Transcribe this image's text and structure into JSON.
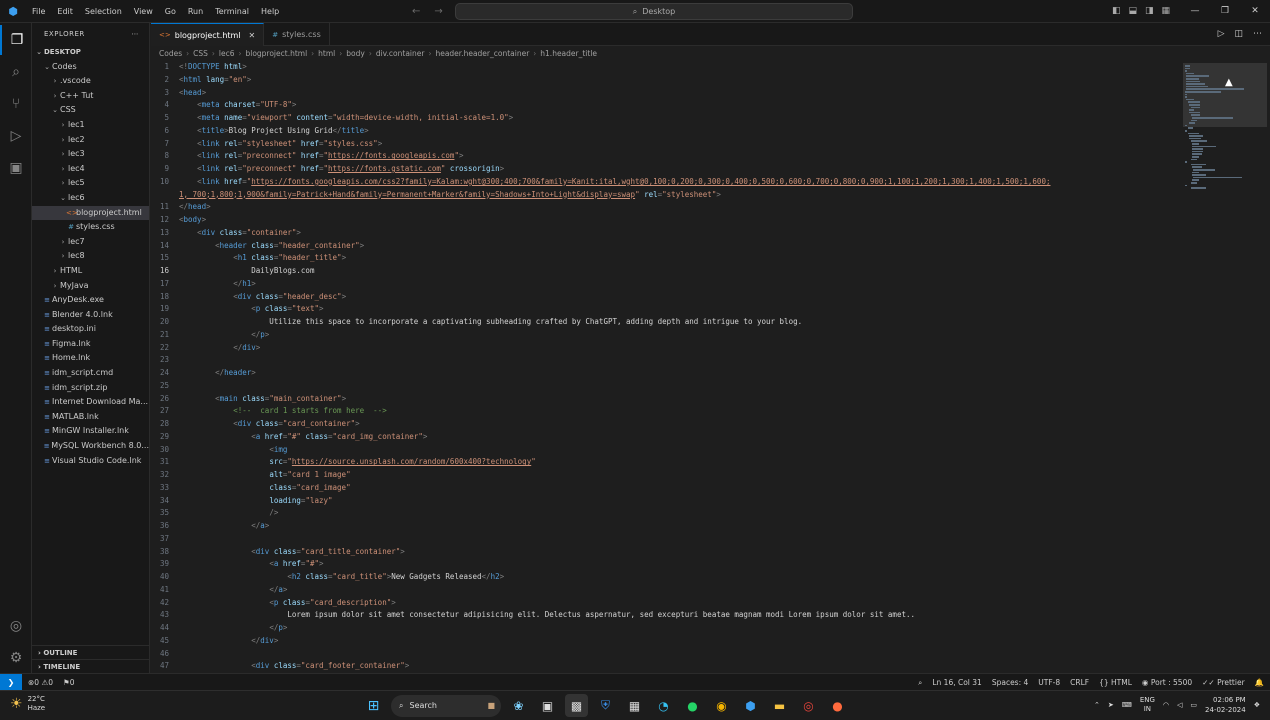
{
  "titlebar": {
    "menu": [
      "File",
      "Edit",
      "Selection",
      "View",
      "Go",
      "Run",
      "Terminal",
      "Help"
    ],
    "search_text": "Desktop"
  },
  "explorer": {
    "header": "EXPLORER",
    "root": "DESKTOP",
    "items": [
      {
        "label": "Codes",
        "depth": 1,
        "type": "folder-open"
      },
      {
        "label": ".vscode",
        "depth": 2,
        "type": "folder"
      },
      {
        "label": "C++ Tut",
        "depth": 2,
        "type": "folder"
      },
      {
        "label": "CSS",
        "depth": 2,
        "type": "folder-open"
      },
      {
        "label": "lec1",
        "depth": 3,
        "type": "folder"
      },
      {
        "label": "lec2",
        "depth": 3,
        "type": "folder"
      },
      {
        "label": "lec3",
        "depth": 3,
        "type": "folder"
      },
      {
        "label": "lec4",
        "depth": 3,
        "type": "folder"
      },
      {
        "label": "lec5",
        "depth": 3,
        "type": "folder"
      },
      {
        "label": "lec6",
        "depth": 3,
        "type": "folder-open"
      },
      {
        "label": "blogproject.html",
        "depth": 4,
        "type": "html",
        "selected": true
      },
      {
        "label": "styles.css",
        "depth": 4,
        "type": "css"
      },
      {
        "label": "lec7",
        "depth": 3,
        "type": "folder"
      },
      {
        "label": "lec8",
        "depth": 3,
        "type": "folder"
      },
      {
        "label": "HTML",
        "depth": 2,
        "type": "folder"
      },
      {
        "label": "MyJava",
        "depth": 2,
        "type": "folder"
      },
      {
        "label": "AnyDesk.exe",
        "depth": 1,
        "type": "file"
      },
      {
        "label": "Blender 4.0.lnk",
        "depth": 1,
        "type": "file"
      },
      {
        "label": "desktop.ini",
        "depth": 1,
        "type": "file"
      },
      {
        "label": "Figma.lnk",
        "depth": 1,
        "type": "file"
      },
      {
        "label": "Home.lnk",
        "depth": 1,
        "type": "file"
      },
      {
        "label": "idm_script.cmd",
        "depth": 1,
        "type": "file"
      },
      {
        "label": "idm_script.zip",
        "depth": 1,
        "type": "file"
      },
      {
        "label": "Internet Download Ma...",
        "depth": 1,
        "type": "file"
      },
      {
        "label": "MATLAB.lnk",
        "depth": 1,
        "type": "file"
      },
      {
        "label": "MinGW Installer.lnk",
        "depth": 1,
        "type": "file"
      },
      {
        "label": "MySQL Workbench 8.0...",
        "depth": 1,
        "type": "file"
      },
      {
        "label": "Visual Studio Code.lnk",
        "depth": 1,
        "type": "file"
      }
    ],
    "outline": "OUTLINE",
    "timeline": "TIMELINE"
  },
  "tabs": [
    {
      "label": "blogproject.html",
      "active": true
    },
    {
      "label": "styles.css",
      "active": false
    }
  ],
  "breadcrumb": [
    "Codes",
    "CSS",
    "lec6",
    "blogproject.html",
    "html",
    "body",
    "div.container",
    "header.header_container",
    "h1.header_title"
  ],
  "code": {
    "current_line": 16,
    "lines": [
      [
        [
          "p",
          "<!"
        ],
        [
          "t",
          "DOCTYPE"
        ],
        [
          "a",
          " html"
        ],
        [
          "p",
          ">"
        ]
      ],
      [
        [
          "p",
          "<"
        ],
        [
          "t",
          "html"
        ],
        [
          "a",
          " lang"
        ],
        [
          "p",
          "="
        ],
        [
          "s",
          "\"en\""
        ],
        [
          "p",
          ">"
        ]
      ],
      [
        [
          "p",
          "<"
        ],
        [
          "t",
          "head"
        ],
        [
          "p",
          ">"
        ]
      ],
      [
        [
          "x",
          "    "
        ],
        [
          "p",
          "<"
        ],
        [
          "t",
          "meta"
        ],
        [
          "a",
          " charset"
        ],
        [
          "p",
          "="
        ],
        [
          "s",
          "\"UTF-8\""
        ],
        [
          "p",
          ">"
        ]
      ],
      [
        [
          "x",
          "    "
        ],
        [
          "p",
          "<"
        ],
        [
          "t",
          "meta"
        ],
        [
          "a",
          " name"
        ],
        [
          "p",
          "="
        ],
        [
          "s",
          "\"viewport\""
        ],
        [
          "a",
          " content"
        ],
        [
          "p",
          "="
        ],
        [
          "s",
          "\"width=device-width, initial-scale=1.0\""
        ],
        [
          "p",
          ">"
        ]
      ],
      [
        [
          "x",
          "    "
        ],
        [
          "p",
          "<"
        ],
        [
          "t",
          "title"
        ],
        [
          "p",
          ">"
        ],
        [
          "x",
          "Blog Project Using Grid"
        ],
        [
          "p",
          "</"
        ],
        [
          "t",
          "title"
        ],
        [
          "p",
          ">"
        ]
      ],
      [
        [
          "x",
          "    "
        ],
        [
          "p",
          "<"
        ],
        [
          "t",
          "link"
        ],
        [
          "a",
          " rel"
        ],
        [
          "p",
          "="
        ],
        [
          "s",
          "\"stylesheet\""
        ],
        [
          "a",
          " href"
        ],
        [
          "p",
          "="
        ],
        [
          "s",
          "\"styles.css\""
        ],
        [
          "p",
          ">"
        ]
      ],
      [
        [
          "x",
          "    "
        ],
        [
          "p",
          "<"
        ],
        [
          "t",
          "link"
        ],
        [
          "a",
          " rel"
        ],
        [
          "p",
          "="
        ],
        [
          "s",
          "\"preconnect\""
        ],
        [
          "a",
          " href"
        ],
        [
          "p",
          "="
        ],
        [
          "s",
          "\""
        ],
        [
          "u",
          "https://fonts.googleapis.com"
        ],
        [
          "s",
          "\""
        ],
        [
          "p",
          ">"
        ]
      ],
      [
        [
          "x",
          "    "
        ],
        [
          "p",
          "<"
        ],
        [
          "t",
          "link"
        ],
        [
          "a",
          " rel"
        ],
        [
          "p",
          "="
        ],
        [
          "s",
          "\"preconnect\""
        ],
        [
          "a",
          " href"
        ],
        [
          "p",
          "="
        ],
        [
          "s",
          "\""
        ],
        [
          "u",
          "https://fonts.gstatic.com"
        ],
        [
          "s",
          "\""
        ],
        [
          "a",
          " crossorigin"
        ],
        [
          "p",
          ">"
        ]
      ],
      [
        [
          "x",
          "    "
        ],
        [
          "p",
          "<"
        ],
        [
          "t",
          "link"
        ],
        [
          "a",
          " href"
        ],
        [
          "p",
          "="
        ],
        [
          "s",
          "\""
        ],
        [
          "u",
          "https://fonts.googleapis.com/css2?family=Kalam:wght@300;400;700&family=Kanit:ital,wght@0,100;0,200;0,300;0,400;0,500;0,600;0,700;0,800;0,900;1,100;1,200;1,300;1,400;1,500;1,600;"
        ]
      ],
      [
        [
          "u",
          "1, 700;1,800;1,900&family=Patrick+Hand&family=Permanent+Marker&family=Shadows+Into+Light&display=swap"
        ],
        [
          "s",
          "\""
        ],
        [
          "a",
          " rel"
        ],
        [
          "p",
          "="
        ],
        [
          "s",
          "\"stylesheet\""
        ],
        [
          "p",
          ">"
        ]
      ],
      [
        [
          "p",
          "</"
        ],
        [
          "t",
          "head"
        ],
        [
          "p",
          ">"
        ]
      ],
      [
        [
          "p",
          "<"
        ],
        [
          "t",
          "body"
        ],
        [
          "p",
          ">"
        ]
      ],
      [
        [
          "x",
          "    "
        ],
        [
          "p",
          "<"
        ],
        [
          "t",
          "div"
        ],
        [
          "a",
          " class"
        ],
        [
          "p",
          "="
        ],
        [
          "s",
          "\"container\""
        ],
        [
          "p",
          ">"
        ]
      ],
      [
        [
          "x",
          "        "
        ],
        [
          "p",
          "<"
        ],
        [
          "t",
          "header"
        ],
        [
          "a",
          " class"
        ],
        [
          "p",
          "="
        ],
        [
          "s",
          "\"header_container\""
        ],
        [
          "p",
          ">"
        ]
      ],
      [
        [
          "x",
          "            "
        ],
        [
          "p",
          "<"
        ],
        [
          "t",
          "h1"
        ],
        [
          "a",
          " class"
        ],
        [
          "p",
          "="
        ],
        [
          "s",
          "\"header_title\""
        ],
        [
          "p",
          ">"
        ]
      ],
      [
        [
          "x",
          "                DailyBlogs.com"
        ]
      ],
      [
        [
          "x",
          "            "
        ],
        [
          "p",
          "</"
        ],
        [
          "t",
          "h1"
        ],
        [
          "p",
          ">"
        ]
      ],
      [
        [
          "x",
          "            "
        ],
        [
          "p",
          "<"
        ],
        [
          "t",
          "div"
        ],
        [
          "a",
          " class"
        ],
        [
          "p",
          "="
        ],
        [
          "s",
          "\"header_desc\""
        ],
        [
          "p",
          ">"
        ]
      ],
      [
        [
          "x",
          "                "
        ],
        [
          "p",
          "<"
        ],
        [
          "t",
          "p"
        ],
        [
          "a",
          " class"
        ],
        [
          "p",
          "="
        ],
        [
          "s",
          "\"text\""
        ],
        [
          "p",
          ">"
        ]
      ],
      [
        [
          "x",
          "                    Utilize this space to incorporate a captivating subheading crafted by ChatGPT, adding depth and intrigue to your blog."
        ]
      ],
      [
        [
          "x",
          "                "
        ],
        [
          "p",
          "</"
        ],
        [
          "t",
          "p"
        ],
        [
          "p",
          ">"
        ]
      ],
      [
        [
          "x",
          "            "
        ],
        [
          "p",
          "</"
        ],
        [
          "t",
          "div"
        ],
        [
          "p",
          ">"
        ]
      ],
      [
        [
          "x",
          ""
        ]
      ],
      [
        [
          "x",
          "        "
        ],
        [
          "p",
          "</"
        ],
        [
          "t",
          "header"
        ],
        [
          "p",
          ">"
        ]
      ],
      [
        [
          "x",
          ""
        ]
      ],
      [
        [
          "x",
          "        "
        ],
        [
          "p",
          "<"
        ],
        [
          "t",
          "main"
        ],
        [
          "a",
          " class"
        ],
        [
          "p",
          "="
        ],
        [
          "s",
          "\"main_container\""
        ],
        [
          "p",
          ">"
        ]
      ],
      [
        [
          "x",
          "            "
        ],
        [
          "c",
          "<!--  card 1 starts from here  -->"
        ]
      ],
      [
        [
          "x",
          "            "
        ],
        [
          "p",
          "<"
        ],
        [
          "t",
          "div"
        ],
        [
          "a",
          " class"
        ],
        [
          "p",
          "="
        ],
        [
          "s",
          "\"card_container\""
        ],
        [
          "p",
          ">"
        ]
      ],
      [
        [
          "x",
          "                "
        ],
        [
          "p",
          "<"
        ],
        [
          "t",
          "a"
        ],
        [
          "a",
          " href"
        ],
        [
          "p",
          "="
        ],
        [
          "s",
          "\"#\""
        ],
        [
          "a",
          " class"
        ],
        [
          "p",
          "="
        ],
        [
          "s",
          "\"card_img_container\""
        ],
        [
          "p",
          ">"
        ]
      ],
      [
        [
          "x",
          "                    "
        ],
        [
          "p",
          "<"
        ],
        [
          "t",
          "img"
        ]
      ],
      [
        [
          "x",
          "                    "
        ],
        [
          "a",
          "src"
        ],
        [
          "p",
          "="
        ],
        [
          "s",
          "\""
        ],
        [
          "u",
          "https://source.unsplash.com/random/600x400?technology"
        ],
        [
          "s",
          "\""
        ]
      ],
      [
        [
          "x",
          "                    "
        ],
        [
          "a",
          "alt"
        ],
        [
          "p",
          "="
        ],
        [
          "s",
          "\"card 1 image\""
        ]
      ],
      [
        [
          "x",
          "                    "
        ],
        [
          "a",
          "class"
        ],
        [
          "p",
          "="
        ],
        [
          "s",
          "\"card_image\""
        ]
      ],
      [
        [
          "x",
          "                    "
        ],
        [
          "a",
          "loading"
        ],
        [
          "p",
          "="
        ],
        [
          "s",
          "\"lazy\""
        ]
      ],
      [
        [
          "x",
          "                    "
        ],
        [
          "p",
          "/>"
        ]
      ],
      [
        [
          "x",
          "                "
        ],
        [
          "p",
          "</"
        ],
        [
          "t",
          "a"
        ],
        [
          "p",
          ">"
        ]
      ],
      [
        [
          "x",
          ""
        ]
      ],
      [
        [
          "x",
          "                "
        ],
        [
          "p",
          "<"
        ],
        [
          "t",
          "div"
        ],
        [
          "a",
          " class"
        ],
        [
          "p",
          "="
        ],
        [
          "s",
          "\"card_title_container\""
        ],
        [
          "p",
          ">"
        ]
      ],
      [
        [
          "x",
          "                    "
        ],
        [
          "p",
          "<"
        ],
        [
          "t",
          "a"
        ],
        [
          "a",
          " href"
        ],
        [
          "p",
          "="
        ],
        [
          "s",
          "\"#\""
        ],
        [
          "p",
          ">"
        ]
      ],
      [
        [
          "x",
          "                        "
        ],
        [
          "p",
          "<"
        ],
        [
          "t",
          "h2"
        ],
        [
          "a",
          " class"
        ],
        [
          "p",
          "="
        ],
        [
          "s",
          "\"card_title\""
        ],
        [
          "p",
          ">"
        ],
        [
          "x",
          "New Gadgets Released"
        ],
        [
          "p",
          "</"
        ],
        [
          "t",
          "h2"
        ],
        [
          "p",
          ">"
        ]
      ],
      [
        [
          "x",
          "                    "
        ],
        [
          "p",
          "</"
        ],
        [
          "t",
          "a"
        ],
        [
          "p",
          ">"
        ]
      ],
      [
        [
          "x",
          "                    "
        ],
        [
          "p",
          "<"
        ],
        [
          "t",
          "p"
        ],
        [
          "a",
          " class"
        ],
        [
          "p",
          "="
        ],
        [
          "s",
          "\"card_description\""
        ],
        [
          "p",
          ">"
        ]
      ],
      [
        [
          "x",
          "                        Lorem ipsum dolor sit amet consectetur adipisicing elit. Delectus aspernatur, sed excepturi beatae magnam modi Lorem ipsum dolor sit amet.."
        ]
      ],
      [
        [
          "x",
          "                    "
        ],
        [
          "p",
          "</"
        ],
        [
          "t",
          "p"
        ],
        [
          "p",
          ">"
        ]
      ],
      [
        [
          "x",
          "                "
        ],
        [
          "p",
          "</"
        ],
        [
          "t",
          "div"
        ],
        [
          "p",
          ">"
        ]
      ],
      [
        [
          "x",
          ""
        ]
      ],
      [
        [
          "x",
          "                "
        ],
        [
          "p",
          "<"
        ],
        [
          "t",
          "div"
        ],
        [
          "a",
          " class"
        ],
        [
          "p",
          "="
        ],
        [
          "s",
          "\"card_footer_container\""
        ],
        [
          "p",
          ">"
        ]
      ]
    ],
    "line_numbers": [
      "1",
      "2",
      "3",
      "4",
      "5",
      "6",
      "7",
      "8",
      "9",
      "10",
      "",
      "11",
      "12",
      "13",
      "14",
      "15",
      "16",
      "17",
      "18",
      "19",
      "20",
      "21",
      "22",
      "23",
      "24",
      "25",
      "26",
      "27",
      "28",
      "29",
      "30",
      "31",
      "32",
      "33",
      "34",
      "35",
      "36",
      "37",
      "38",
      "39",
      "40",
      "41",
      "42",
      "43",
      "44",
      "45",
      "46",
      "47"
    ]
  },
  "statusbar": {
    "errors": "0",
    "warnings": "0",
    "ports": "0",
    "position": "Ln 16, Col 31",
    "spaces": "Spaces: 4",
    "encoding": "UTF-8",
    "eol": "CRLF",
    "language": "HTML",
    "port": "Port : 5500",
    "prettier": "Prettier"
  },
  "taskbar": {
    "temperature": "22°C",
    "weather": "Haze",
    "search": "Search",
    "lang_top": "ENG",
    "lang_bottom": "IN",
    "time": "02:06 PM",
    "date": "24-02-2024"
  }
}
